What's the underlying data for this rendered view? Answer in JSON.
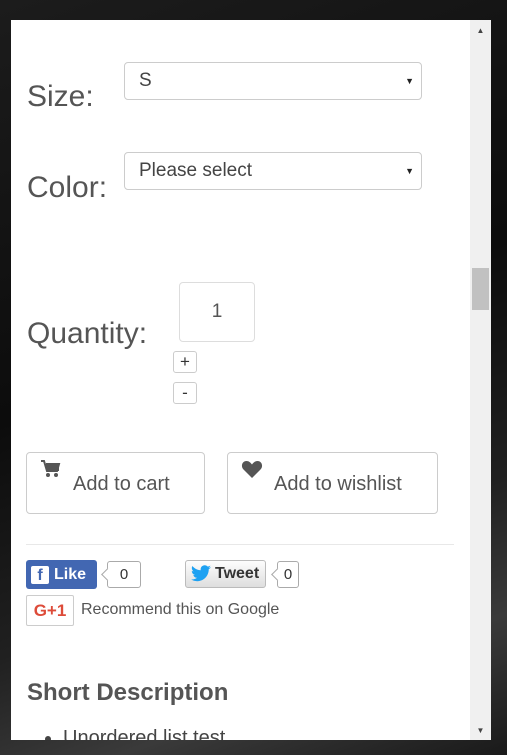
{
  "options": {
    "size_label": "Size:",
    "size_value": "S",
    "color_label": "Color:",
    "color_value": "Please select",
    "quantity_label": "Quantity:",
    "quantity_value": "1",
    "plus_label": "+",
    "minus_label": "-"
  },
  "actions": {
    "add_to_cart": "Add to cart",
    "add_to_wishlist": "Add to wishlist"
  },
  "social": {
    "like_label": "Like",
    "like_count": "0",
    "tweet_label": "Tweet",
    "tweet_count": "0",
    "gplus_label": "G+1",
    "gplus_text": "Recommend this on Google",
    "facebook_color": "#4267b2",
    "twitter_color": "#1da1f2",
    "gplus_color": "#dd4b39"
  },
  "description": {
    "heading": "Short Description",
    "items": [
      "Unordered list test"
    ]
  },
  "icons": [
    "cart-icon",
    "heart-icon",
    "facebook-icon",
    "twitter-bird-icon",
    "scroll-up-arrow-icon",
    "scroll-down-arrow-icon",
    "dropdown-arrow-icon"
  ]
}
